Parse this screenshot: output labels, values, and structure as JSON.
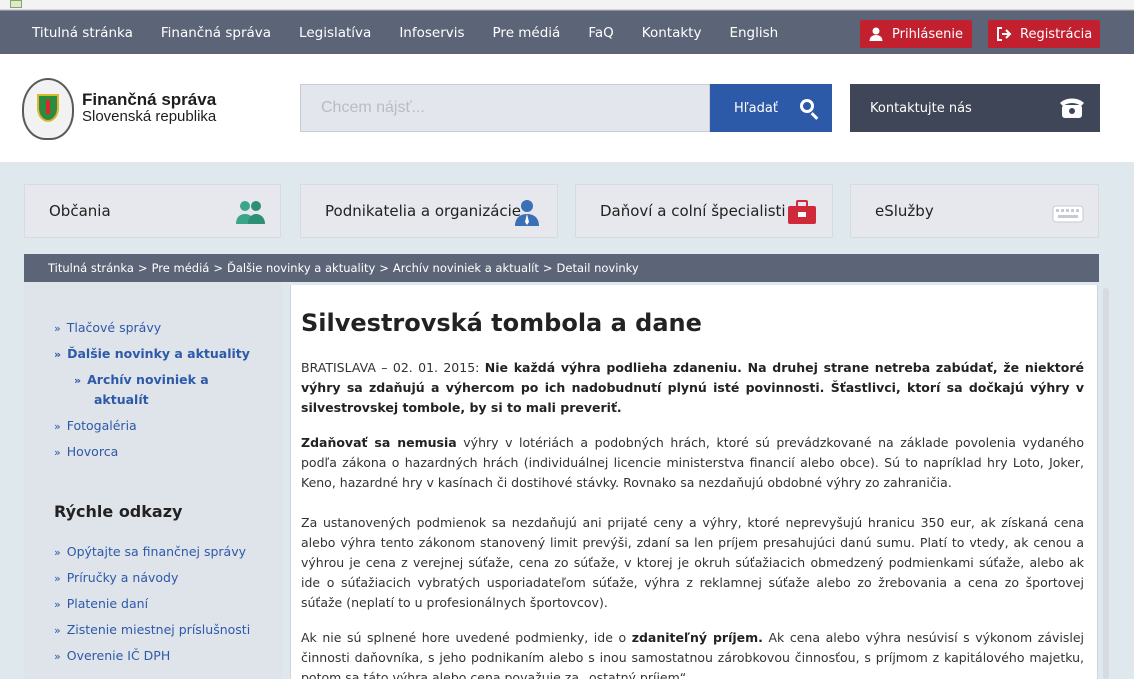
{
  "topnav": {
    "links": [
      "Titulná stránka",
      "Finančná správa",
      "Legislatíva",
      "Infoservis",
      "Pre médiá",
      "FaQ",
      "Kontakty",
      "English"
    ],
    "login_label": "Prihlásenie",
    "register_label": "Registrácia"
  },
  "header": {
    "logo_title": "Finančná správa",
    "logo_subtitle": "Slovenská republika",
    "search_placeholder": "Chcem nájsť...",
    "search_button": "Hľadať",
    "contact_button": "Kontaktujte nás"
  },
  "categories": [
    "Občania",
    "Podnikatelia a organizácie",
    "Daňoví a colní špecialisti",
    "eSlužby"
  ],
  "breadcrumb": [
    "Titulná stránka",
    ">",
    "Pre médiá",
    ">",
    "Ďalšie novinky a aktuality",
    ">",
    "Archív noviniek a aktualít",
    ">",
    "Detail novinky"
  ],
  "sidebar": {
    "links": [
      {
        "label": "Tlačové správy"
      },
      {
        "label": "Ďalšie novinky a aktuality"
      },
      {
        "label": "Archív noviniek a"
      },
      {
        "label": "aktualít"
      },
      {
        "label": "Fotogaléria"
      },
      {
        "label": "Hovorca"
      }
    ],
    "quick_heading": "Rýchle odkazy",
    "quick_links": [
      {
        "label": "Opýtajte sa finančnej správy"
      },
      {
        "label": "Príručky a návody"
      },
      {
        "label": "Platenie daní"
      },
      {
        "label": "Zistenie miestnej príslušnosti"
      },
      {
        "label": "Overenie IČ DPH"
      }
    ]
  },
  "article": {
    "title": "Silvestrovská tombola a dane",
    "lead_prefix": "BRATISLAVA – 02. 01. 2015:",
    "lead_bold": "Nie každá výhra podlieha zdaneniu. Na druhej strane netreba zabúdať, že niektoré výhry sa zdaňujú a výhercom po ich nadobudnutí plynú isté povinnosti. Šťastlivci, ktorí sa dočkajú výhry v silvestrovskej tombole, by si to mali preveriť.",
    "p1_bold": "Zdaňovať sa nemusia",
    "p1_text": " výhry v lotériách a podobných hrách, ktoré sú prevádzkované na základe povolenia vydaného podľa zákona o hazardných hrách (individuálnej licencie ministerstva financií alebo obce). Sú to napríklad hry Loto, Joker, Keno, hazardné hry v kasínach či dostihové stávky. Rovnako sa nezdaňujú obdobné výhry zo zahraničia.",
    "p2_text": "Za ustanovených podmienok sa nezdaňujú ani prijaté ceny a výhry, ktoré neprevyšujú hranicu 350 eur, ak získaná cena alebo výhra tento zákonom stanovený limit prevýši, zdaní sa len príjem presahujúci danú sumu. Platí to vtedy, ak cenou a výhrou je cena z verejnej súťaže, cena zo súťaže, v ktorej je okruh súťažiacich obmedzený podmienkami súťaže, alebo ak ide o súťažiacich vybratých usporiadateľom súťaže, výhra z reklamnej súťaže alebo zo žrebovania a cena zo športovej súťaže (neplatí to u profesionálnych športovcov).",
    "p3_pre": "Ak nie sú splnené hore uvedené podmienky, ide o ",
    "p3_bold": "zdaniteľný príjem.",
    "p3_text": " Ak cena alebo výhra nesúvisí s výkonom závislej činnosti daňovníka, s jeho podnikaním alebo s inou samostatnou zárobkovou činnosťou, s príjmom z kapitálového majetku, potom sa táto výhra alebo cena považuje za „ostatný príjem“."
  },
  "colors": {
    "nav_bg": "#5c6577",
    "accent_red": "#c2202f",
    "accent_blue": "#2d5aa8",
    "page_bg": "#dfe8ec"
  }
}
